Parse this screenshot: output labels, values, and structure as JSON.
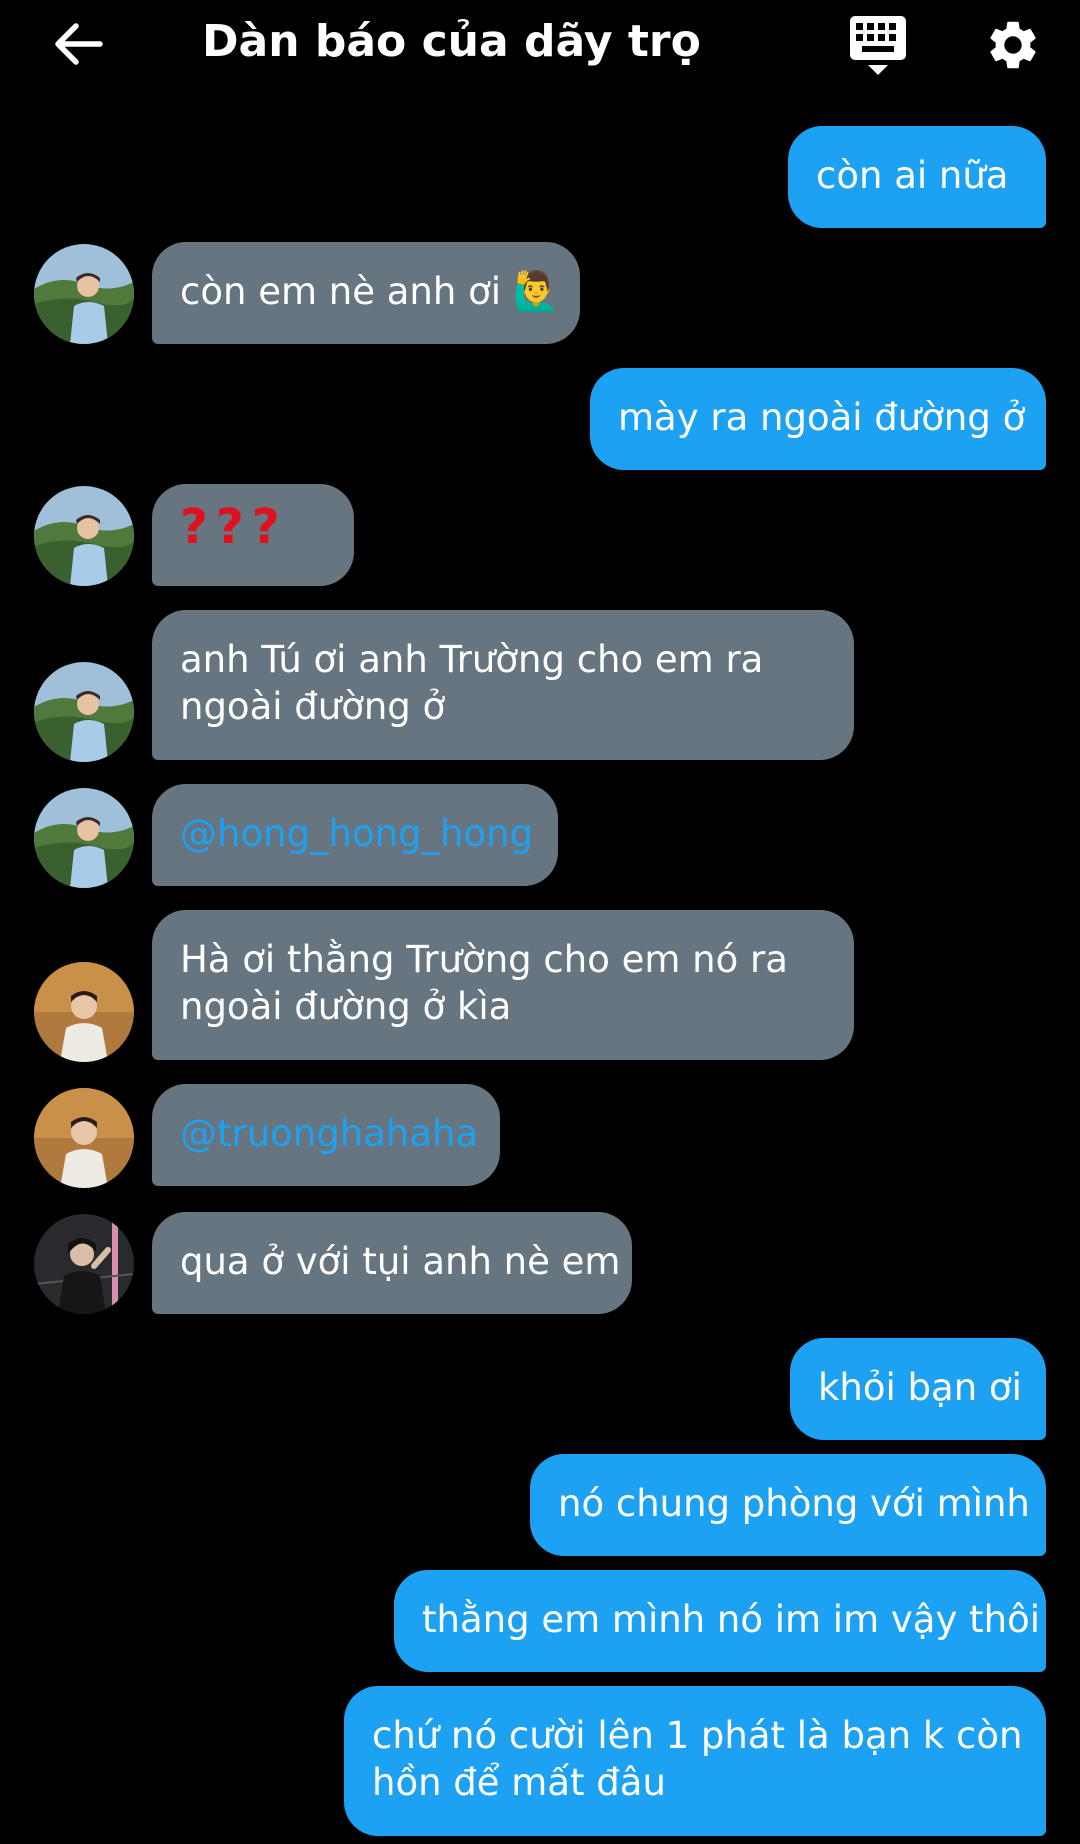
{
  "header": {
    "title": "Dàn báo của dãy trọ",
    "back_icon": "arrow-left-icon",
    "keyboard_icon": "keyboard-icon",
    "settings_icon": "gear-icon"
  },
  "colors": {
    "outgoing_bubble": "#1da1f2",
    "incoming_bubble": "#66757f",
    "mention": "#1da1f2",
    "background": "#000000"
  },
  "messages": [
    {
      "direction": "out",
      "text": "còn ai nữa"
    },
    {
      "direction": "in",
      "sender_avatar": "avatar-a",
      "text": "còn em nè anh ơi",
      "emoji": "🙋‍♂️"
    },
    {
      "direction": "out",
      "text": "mày ra ngoài đường ở"
    },
    {
      "direction": "in",
      "sender_avatar": "avatar-a",
      "text": "???"
    },
    {
      "direction": "in",
      "sender_avatar": "avatar-a",
      "lines": [
        "anh Tú ơi anh Trường cho em ra",
        "ngoài đường ở"
      ]
    },
    {
      "direction": "in",
      "sender_avatar": "avatar-a",
      "text": "@hong_hong_hong"
    },
    {
      "direction": "in",
      "sender_avatar": "avatar-b",
      "lines": [
        "Hà ơi thằng Trường cho em nó ra",
        "ngoài đường ở kìa"
      ]
    },
    {
      "direction": "in",
      "sender_avatar": "avatar-b",
      "text": "@truonghahaha"
    },
    {
      "direction": "in",
      "sender_avatar": "avatar-c",
      "text": "qua ở với tụi anh nè em"
    },
    {
      "direction": "out",
      "text": "khỏi bạn ơi"
    },
    {
      "direction": "out",
      "text": "nó chung phòng với mình"
    },
    {
      "direction": "out",
      "text": "thằng em mình nó im im vậy thôi"
    },
    {
      "direction": "out",
      "lines": [
        "chứ nó cười lên 1 phát là bạn k còn",
        "hồn để mất đâu"
      ]
    }
  ]
}
